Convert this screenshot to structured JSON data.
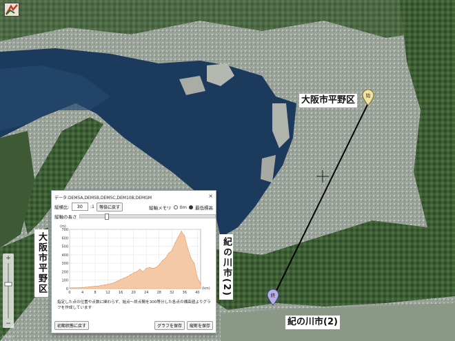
{
  "map": {
    "start_label": "大阪市平野区",
    "end_label": "紀の川市(2)",
    "left_label": "大阪市平野区",
    "mid_label": "紀の川市(2)",
    "start_pin_text": "始",
    "end_pin_text": "終",
    "scale_text": "5 km"
  },
  "dialog": {
    "title": "データ:DEM5A,DEM5B,DEM5C,DEM10B,DEMGM",
    "close": "×",
    "ratio_label": "縦横比:",
    "ratio_value": "30",
    "ratio_suffix": ":1",
    "reset_ratio_button": "等倍に戻す",
    "axis_memory_label": "縦軸メモリ",
    "opt_zero": "0m",
    "opt_min": "最低標高",
    "axis_length_label": "縦軸の長さ",
    "note": "指定した点の位置や点数に関わらず、始点～終点間を300等分した各点の標高値よりグラフを作成しています",
    "reset_view_button": "初期状態に戻す",
    "save_graph_button": "グラフを保存",
    "save_profile_button": "縦断を保存"
  },
  "chart_data": {
    "type": "area",
    "ylabel": "(m)",
    "xlabel": "(km)",
    "xlim": [
      0,
      41
    ],
    "ylim": [
      0,
      700
    ],
    "xticks": [
      0,
      4,
      8,
      12,
      16,
      20,
      24,
      28,
      32,
      36,
      40
    ],
    "yticks": [
      0,
      100,
      200,
      300,
      400,
      500,
      600,
      700
    ],
    "color": "#f5c9a5",
    "x": [
      0,
      1,
      2,
      3,
      4,
      5,
      6,
      7,
      8,
      9,
      10,
      11,
      12,
      13,
      14,
      15,
      16,
      17,
      18,
      19,
      20,
      21,
      22,
      23,
      24,
      25,
      26,
      27,
      28,
      29,
      30,
      31,
      32,
      33,
      34,
      35,
      36,
      37,
      38,
      39,
      40,
      41
    ],
    "y": [
      10,
      10,
      11,
      12,
      14,
      17,
      20,
      25,
      28,
      31,
      38,
      45,
      52,
      60,
      72,
      90,
      110,
      125,
      140,
      165,
      185,
      200,
      230,
      200,
      240,
      250,
      240,
      250,
      280,
      330,
      360,
      420,
      450,
      540,
      610,
      680,
      620,
      470,
      360,
      300,
      130,
      60
    ]
  }
}
